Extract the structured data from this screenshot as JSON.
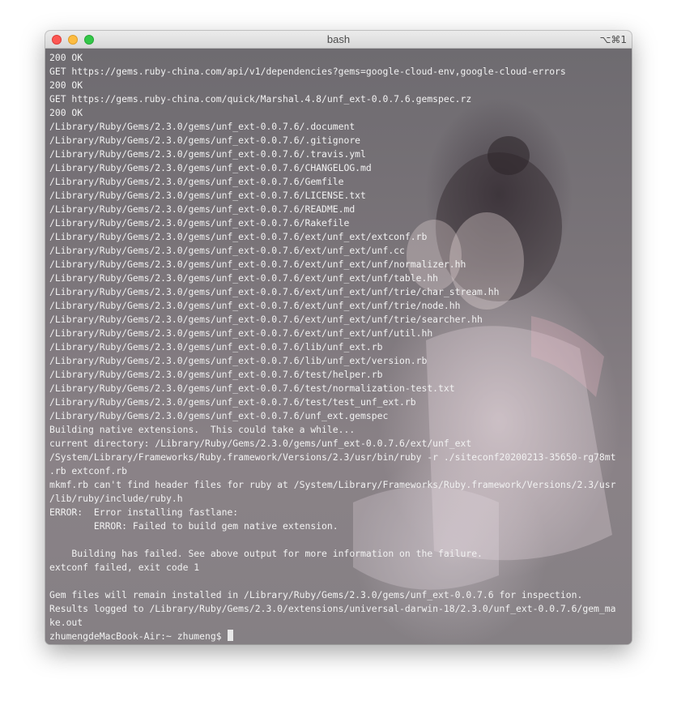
{
  "window": {
    "title": "bash",
    "shortcut": "⌥⌘1"
  },
  "terminal": {
    "lines": [
      "200 OK",
      "GET https://gems.ruby-china.com/api/v1/dependencies?gems=google-cloud-env,google-cloud-errors",
      "200 OK",
      "GET https://gems.ruby-china.com/quick/Marshal.4.8/unf_ext-0.0.7.6.gemspec.rz",
      "200 OK",
      "/Library/Ruby/Gems/2.3.0/gems/unf_ext-0.0.7.6/.document",
      "/Library/Ruby/Gems/2.3.0/gems/unf_ext-0.0.7.6/.gitignore",
      "/Library/Ruby/Gems/2.3.0/gems/unf_ext-0.0.7.6/.travis.yml",
      "/Library/Ruby/Gems/2.3.0/gems/unf_ext-0.0.7.6/CHANGELOG.md",
      "/Library/Ruby/Gems/2.3.0/gems/unf_ext-0.0.7.6/Gemfile",
      "/Library/Ruby/Gems/2.3.0/gems/unf_ext-0.0.7.6/LICENSE.txt",
      "/Library/Ruby/Gems/2.3.0/gems/unf_ext-0.0.7.6/README.md",
      "/Library/Ruby/Gems/2.3.0/gems/unf_ext-0.0.7.6/Rakefile",
      "/Library/Ruby/Gems/2.3.0/gems/unf_ext-0.0.7.6/ext/unf_ext/extconf.rb",
      "/Library/Ruby/Gems/2.3.0/gems/unf_ext-0.0.7.6/ext/unf_ext/unf.cc",
      "/Library/Ruby/Gems/2.3.0/gems/unf_ext-0.0.7.6/ext/unf_ext/unf/normalizer.hh",
      "/Library/Ruby/Gems/2.3.0/gems/unf_ext-0.0.7.6/ext/unf_ext/unf/table.hh",
      "/Library/Ruby/Gems/2.3.0/gems/unf_ext-0.0.7.6/ext/unf_ext/unf/trie/char_stream.hh",
      "/Library/Ruby/Gems/2.3.0/gems/unf_ext-0.0.7.6/ext/unf_ext/unf/trie/node.hh",
      "/Library/Ruby/Gems/2.3.0/gems/unf_ext-0.0.7.6/ext/unf_ext/unf/trie/searcher.hh",
      "/Library/Ruby/Gems/2.3.0/gems/unf_ext-0.0.7.6/ext/unf_ext/unf/util.hh",
      "/Library/Ruby/Gems/2.3.0/gems/unf_ext-0.0.7.6/lib/unf_ext.rb",
      "/Library/Ruby/Gems/2.3.0/gems/unf_ext-0.0.7.6/lib/unf_ext/version.rb",
      "/Library/Ruby/Gems/2.3.0/gems/unf_ext-0.0.7.6/test/helper.rb",
      "/Library/Ruby/Gems/2.3.0/gems/unf_ext-0.0.7.6/test/normalization-test.txt",
      "/Library/Ruby/Gems/2.3.0/gems/unf_ext-0.0.7.6/test/test_unf_ext.rb",
      "/Library/Ruby/Gems/2.3.0/gems/unf_ext-0.0.7.6/unf_ext.gemspec",
      "Building native extensions.  This could take a while...",
      "current directory: /Library/Ruby/Gems/2.3.0/gems/unf_ext-0.0.7.6/ext/unf_ext",
      "/System/Library/Frameworks/Ruby.framework/Versions/2.3/usr/bin/ruby -r ./siteconf20200213-35650-rg78mt",
      ".rb extconf.rb",
      "mkmf.rb can't find header files for ruby at /System/Library/Frameworks/Ruby.framework/Versions/2.3/usr",
      "/lib/ruby/include/ruby.h",
      "ERROR:  Error installing fastlane:",
      "        ERROR: Failed to build gem native extension.",
      "",
      "    Building has failed. See above output for more information on the failure.",
      "extconf failed, exit code 1",
      "",
      "Gem files will remain installed in /Library/Ruby/Gems/2.3.0/gems/unf_ext-0.0.7.6 for inspection.",
      "Results logged to /Library/Ruby/Gems/2.3.0/extensions/universal-darwin-18/2.3.0/unf_ext-0.0.7.6/gem_ma",
      "ke.out"
    ],
    "prompt": "zhumengdeMacBook-Air:~ zhumeng$ "
  }
}
